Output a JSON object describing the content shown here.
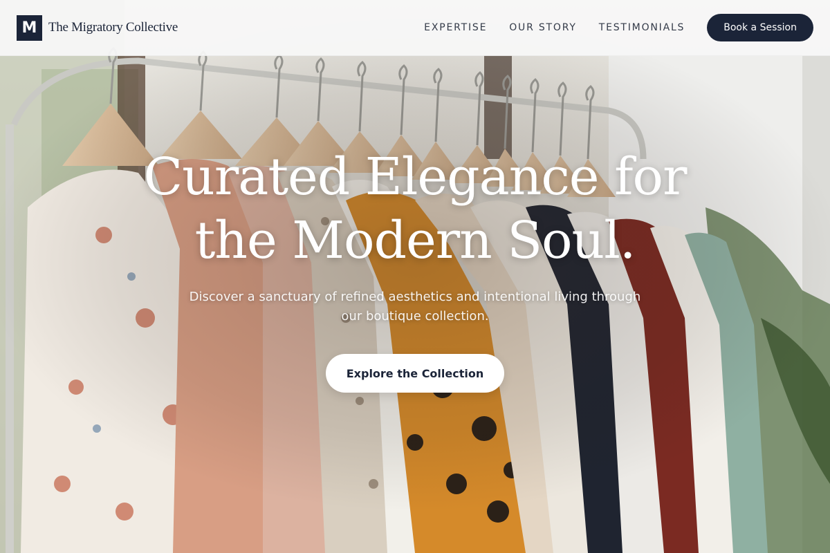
{
  "brand": {
    "mark": "M",
    "name": "The Migratory Collective"
  },
  "nav": {
    "links": [
      "EXPERTISE",
      "OUR STORY",
      "TESTIMONIALS"
    ],
    "cta_label": "Book a Session"
  },
  "hero": {
    "title_line1": "Curated Elegance for",
    "title_line2": "the Modern Soul.",
    "subtitle": "Discover a sanctuary of refined aesthetics and intentional living through our boutique collection.",
    "button_label": "Explore the Collection",
    "image_subject": "clothing rack with hanging garments"
  },
  "colors": {
    "brand_navy": "#1b2438",
    "header_bg": "#f8f8f7",
    "white": "#ffffff"
  }
}
